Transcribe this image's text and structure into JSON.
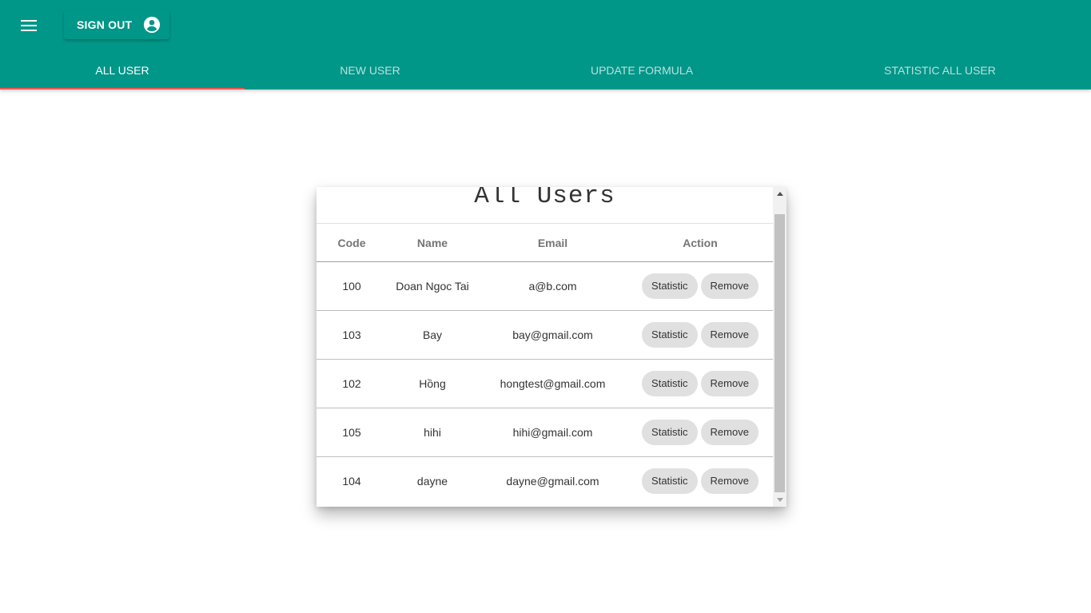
{
  "appbar": {
    "menu_icon": "menu-icon",
    "signout_label": "SIGN OUT",
    "account_icon": "account-circle-icon",
    "color": "#009688"
  },
  "tabs": [
    {
      "label": "ALL USER",
      "active": true
    },
    {
      "label": "NEW USER",
      "active": false
    },
    {
      "label": "UPDATE FORMULA",
      "active": false
    },
    {
      "label": "STATISTIC ALL USER",
      "active": false
    }
  ],
  "tab_indicator_color": "#ff5252",
  "card": {
    "title": "All Users",
    "columns": [
      "Code",
      "Name",
      "Email",
      "Action"
    ],
    "rows": [
      {
        "code": "100",
        "name": "Doan Ngoc Tai",
        "email": "a@b.com"
      },
      {
        "code": "103",
        "name": "Bay",
        "email": "bay@gmail.com"
      },
      {
        "code": "102",
        "name": "Hồng",
        "email": "hongtest@gmail.com"
      },
      {
        "code": "105",
        "name": "hihi",
        "email": "hihi@gmail.com"
      },
      {
        "code": "104",
        "name": "dayne",
        "email": "dayne@gmail.com"
      }
    ],
    "statistic_label": "Statistic",
    "remove_label": "Remove"
  }
}
